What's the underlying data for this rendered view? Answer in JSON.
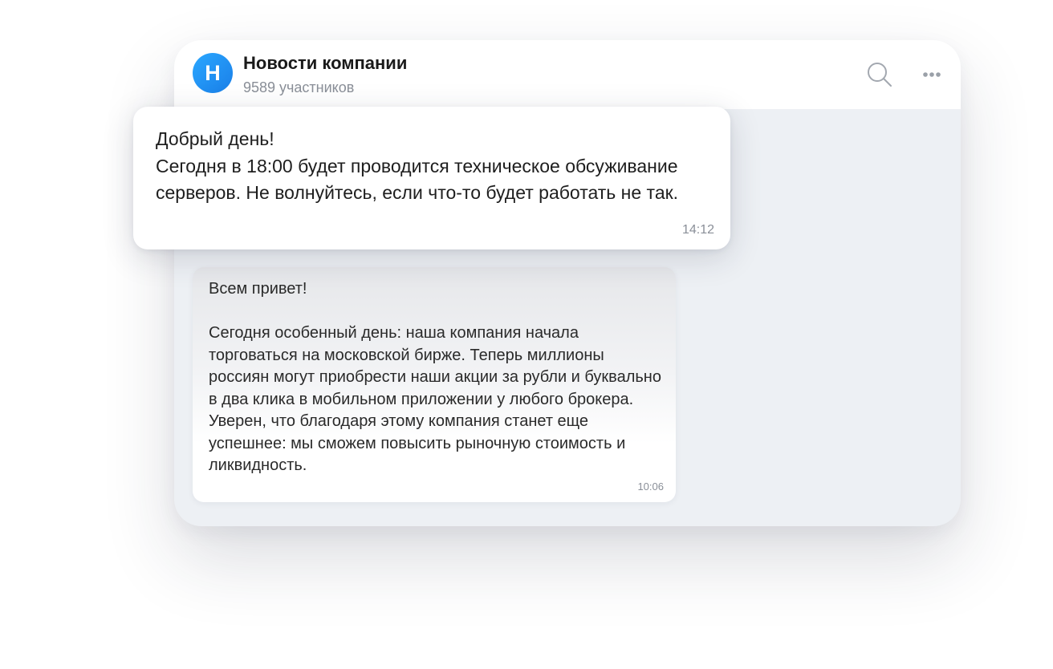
{
  "chat": {
    "avatar_letter": "Н",
    "title": "Новости компании",
    "members": "9589 участников"
  },
  "toolbar": {
    "search_icon": "search-icon",
    "more_icon": "more-dots-icon"
  },
  "messages": [
    {
      "text": "Добрый день!\nСегодня в 18:00 будет проводится техническое обсуживание серверов. Не волнуйтесь, если что-то будет работать не так.",
      "time": "14:12"
    },
    {
      "text": "Всем привет!\n\nСегодня особенный день: наша компания начала торговаться на московской бирже. Теперь миллионы россиян могут приобрести наши акции за рубли и буквально в два клика в мобильном приложении у любого брокера. Уверен, что благодаря этому компания станет еще успешнее: мы сможем повысить рыночную стоимость и ликвидность.",
      "time": "10:06"
    }
  ],
  "colors": {
    "accent": "#1a8cf0",
    "chat_background": "#edf0f4",
    "muted_text": "#8a8f98"
  }
}
